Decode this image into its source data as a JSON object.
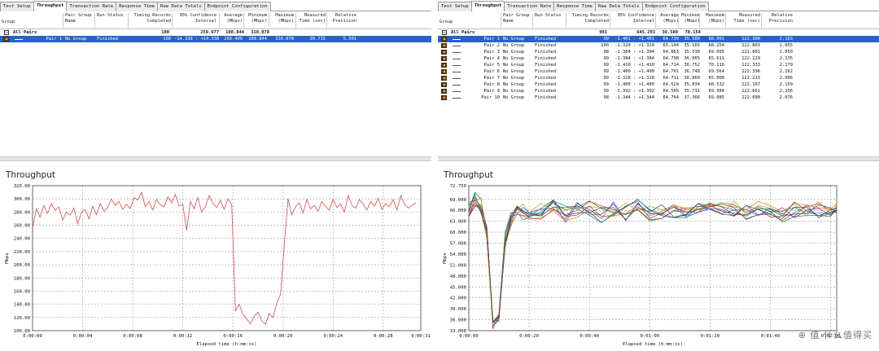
{
  "tabs": [
    "Test Setup",
    "Throughput",
    "Transaction Rate",
    "Response Time",
    "Raw Data Totals",
    "Endpoint Configuration"
  ],
  "active_tab": 1,
  "colors": {
    "selection": "#2962c4",
    "left_series": "#d05050",
    "right_series": [
      "#3b3b3b",
      "#2e7d32",
      "#7b1fa2",
      "#1565c0",
      "#c62828",
      "#00838f",
      "#9e9d24",
      "#6d4c41",
      "#ef6c00",
      "#37474f"
    ]
  },
  "left": {
    "columns": [
      "Group",
      "Pair Group\nName",
      "Run Status",
      "Timing Records\nCompleted",
      "95% Confidence\nInterval",
      "Average\n(Mbps)",
      "Minimum\n(Mbps)",
      "Maximum\n(Mbps)",
      "Measured\nTime (sec)",
      "Relative\nPrecision"
    ],
    "all_row": {
      "label": "All Pairs",
      "records": "100",
      "average": "259.977",
      "minimum": "108.844",
      "maximum": "310.078"
    },
    "rows": [
      {
        "pair": "Pair 1",
        "group": "No Group",
        "status": "Finished",
        "records": "100",
        "ci": "-14.338 : +14.338",
        "average": "260.409",
        "minimum": "108.844",
        "maximum": "310.078",
        "time": "30.715",
        "precision": "5.501"
      }
    ],
    "chart_title": "Throughput",
    "ylabel": "Mbps",
    "xlabel": "Elapsed time (h:mm:ss)"
  },
  "right": {
    "columns": [
      "Group",
      "Pair Group\nName",
      "Run Status",
      "Timing Records\nCompleted",
      "95% Confidence\nInterval",
      "Average\n(Mbps)",
      "Minimum\n(Mbps)",
      "Maximum\n(Mbps)",
      "Measured\nTime (sec)",
      "Relative\nPrecision"
    ],
    "all_row": {
      "label": "All Pairs",
      "records": "991",
      "average": "645.293",
      "minimum": "36.580",
      "maximum": "70.154"
    },
    "rows": [
      {
        "pair": "Pair 1",
        "group": "No Group",
        "status": "Finished",
        "records": "99",
        "ci": "-1.401 : +1.401",
        "average": "64.739",
        "minimum": "35.580",
        "maximum": "68.991",
        "time": "122.300",
        "precision": "2.163"
      },
      {
        "pair": "Pair 2",
        "group": "No Group",
        "status": "Finished",
        "records": "100",
        "ci": "-1.320 : +1.320",
        "average": "65.144",
        "minimum": "35.165",
        "maximum": "68.254",
        "time": "122.803",
        "precision": "2.055"
      },
      {
        "pair": "Pair 3",
        "group": "No Group",
        "status": "Finished",
        "records": "98",
        "ci": "-1.304 : +1.304",
        "average": "64.863",
        "minimum": "35.530",
        "maximum": "69.005",
        "time": "121.801",
        "precision": "2.050"
      },
      {
        "pair": "Pair 4",
        "group": "No Group",
        "status": "Finished",
        "records": "99",
        "ci": "-1.384 : +1.384",
        "average": "64.798",
        "minimum": "36.065",
        "maximum": "65.611",
        "time": "122.229",
        "precision": "2.135"
      },
      {
        "pair": "Pair 5",
        "group": "No Group",
        "status": "Finished",
        "records": "99",
        "ci": "-1.410 : +1.410",
        "average": "64.714",
        "minimum": "36.752",
        "maximum": "70.116",
        "time": "122.333",
        "precision": "2.179"
      },
      {
        "pair": "Pair 6",
        "group": "No Group",
        "status": "Finished",
        "records": "99",
        "ci": "-1.400 : +1.400",
        "average": "64.701",
        "minimum": "36.748",
        "maximum": "69.564",
        "time": "122.396",
        "precision": "2.162"
      },
      {
        "pair": "Pair 7",
        "group": "No Group",
        "status": "Finished",
        "records": "99",
        "ci": "-1.328 : +1.328",
        "average": "64.711",
        "minimum": "36.860",
        "maximum": "65.008",
        "time": "122.213",
        "precision": "2.086"
      },
      {
        "pair": "Pair 8",
        "group": "No Group",
        "status": "Finished",
        "records": "99",
        "ci": "-1.400 : +1.400",
        "average": "64.529",
        "minimum": "35.834",
        "maximum": "68.532",
        "time": "122.167",
        "precision": "2.159"
      },
      {
        "pair": "Pair 9",
        "group": "No Group",
        "status": "Finished",
        "records": "99",
        "ci": "-1.392 : +1.392",
        "average": "64.565",
        "minimum": "35.731",
        "maximum": "69.384",
        "time": "122.661",
        "precision": "2.156"
      },
      {
        "pair": "Pair 10",
        "group": "No Group",
        "status": "Finished",
        "records": "98",
        "ci": "-1.344 : +1.344",
        "average": "64.764",
        "minimum": "37.366",
        "maximum": "69.085",
        "time": "122.090",
        "precision": "2.076"
      }
    ],
    "chart_title": "Throughput",
    "ylabel": "Mbps",
    "xlabel": "Elapsed time (h:mm:ss)"
  },
  "chart_data": [
    {
      "type": "line",
      "title": "Throughput",
      "xlabel": "Elapsed time (h:mm:ss)",
      "ylabel": "Mbps",
      "xlim": [
        0,
        31
      ],
      "ylim": [
        100,
        320
      ],
      "x_ticks": [
        "0:00:00",
        "0:00:04",
        "0:00:08",
        "0:00:12",
        "0:00:16",
        "0:00:20",
        "0:00:24",
        "0:00:28",
        "0:00:31"
      ],
      "x_tick_values": [
        0,
        4,
        8,
        12,
        16,
        20,
        24,
        28,
        31
      ],
      "y_ticks": [
        "100.00",
        "120.00",
        "140.00",
        "160.00",
        "180.00",
        "200.00",
        "220.00",
        "240.00",
        "260.00",
        "280.00",
        "300.00",
        "320.00"
      ],
      "grid": true,
      "series": [
        {
          "x": [
            0,
            0.3,
            0.6,
            0.9,
            1.2,
            1.5,
            1.8,
            2.1,
            2.4,
            2.7,
            3.0,
            3.3,
            3.6,
            3.9,
            4.2,
            4.5,
            4.8,
            5.1,
            5.4,
            5.7,
            6.0,
            6.3,
            6.6,
            6.9,
            7.2,
            7.5,
            7.8,
            8.1,
            8.4,
            8.7,
            9.0,
            9.3,
            9.6,
            9.9,
            10.2,
            10.5,
            10.8,
            11.1,
            11.4,
            11.7,
            12.0,
            12.3,
            12.6,
            12.9,
            13.2,
            13.5,
            13.8,
            14.1,
            14.4,
            14.7,
            15.0,
            15.3,
            15.6,
            15.9,
            16.2,
            16.5,
            16.8,
            17.1,
            17.4,
            17.7,
            18.0,
            18.3,
            18.6,
            18.9,
            19.2,
            19.5,
            19.8,
            20.1,
            20.4,
            20.7,
            21.0,
            21.3,
            21.6,
            21.9,
            22.2,
            22.5,
            22.8,
            23.1,
            23.4,
            23.7,
            24.0,
            24.3,
            24.6,
            24.9,
            25.2,
            25.5,
            25.8,
            26.1,
            26.4,
            26.7,
            27.0,
            27.3,
            27.6,
            27.9,
            28.2,
            28.5,
            28.8,
            29.1,
            29.4,
            29.7,
            30.0,
            30.3,
            30.6
          ],
          "y": [
            255,
            285,
            272,
            290,
            278,
            293,
            282,
            288,
            268,
            280,
            275,
            286,
            262,
            279,
            284,
            270,
            289,
            276,
            293,
            281,
            287,
            300,
            290,
            296,
            284,
            292,
            285,
            302,
            298,
            310,
            288,
            296,
            283,
            299,
            291,
            288,
            303,
            294,
            307,
            289,
            292,
            252,
            296,
            285,
            302,
            280,
            288,
            305,
            293,
            287,
            298,
            284,
            300,
            292,
            130,
            140,
            125,
            118,
            110,
            122,
            128,
            115,
            110,
            126,
            120,
            142,
            155,
            230,
            300,
            276,
            288,
            294,
            279,
            299,
            285,
            290,
            281,
            296,
            288,
            283,
            299,
            287,
            292,
            280,
            305,
            290,
            286,
            299,
            292,
            283,
            296,
            289,
            301,
            284,
            293,
            288,
            299,
            283,
            305,
            292,
            286,
            290,
            294
          ]
        }
      ]
    },
    {
      "type": "line",
      "title": "Throughput",
      "xlabel": "Elapsed time (h:mm:ss)",
      "ylabel": "Mbps",
      "xlim": [
        0,
        122
      ],
      "ylim": [
        33,
        72.75
      ],
      "x_ticks": [
        "0:00:00",
        "0:00:20",
        "0:00:40",
        "0:01:00",
        "0:01:20",
        "0:01:40",
        "0:02:00"
      ],
      "x_tick_values": [
        0,
        20,
        40,
        60,
        80,
        100,
        120
      ],
      "y_ticks": [
        "33.000",
        "36.000",
        "39.000",
        "42.000",
        "45.000",
        "48.000",
        "51.000",
        "54.000",
        "57.000",
        "60.000",
        "63.000",
        "66.000",
        "69.000",
        "72.750"
      ],
      "y_tick_values": [
        33,
        36,
        39,
        42,
        45,
        48,
        51,
        54,
        57,
        60,
        63,
        66,
        69,
        72.75
      ],
      "grid": true,
      "series_count": 10,
      "base_profile": {
        "x": [
          0,
          2,
          4,
          6,
          8,
          10,
          12,
          14,
          16,
          18,
          20,
          24,
          28,
          32,
          36,
          40,
          44,
          48,
          52,
          56,
          60,
          64,
          68,
          72,
          76,
          80,
          84,
          88,
          92,
          96,
          100,
          104,
          108,
          112,
          116,
          120,
          122
        ],
        "y": [
          66,
          69,
          67,
          60,
          35,
          36,
          58,
          64,
          66,
          65.5,
          66,
          65.5,
          66.5,
          65,
          66,
          66.5,
          65,
          66,
          65.5,
          66.5,
          65,
          66,
          66.2,
          65.3,
          66.4,
          65.8,
          65.6,
          66.3,
          65.1,
          66,
          65.7,
          64.8,
          65.9,
          65.2,
          66.1,
          65.4,
          65.8
        ]
      }
    }
  ]
}
